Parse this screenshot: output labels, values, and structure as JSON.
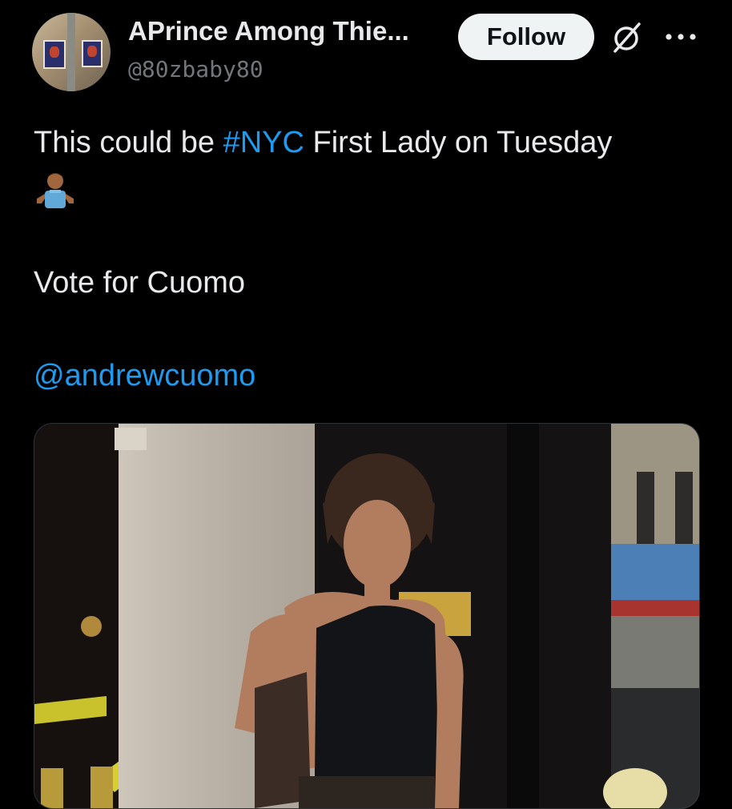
{
  "author": {
    "display_name": "APrince Among Thie...",
    "handle": "@80zbaby80",
    "avatar_icon": "profile-avatar"
  },
  "header": {
    "follow_label": "Follow",
    "grok_icon": "grok-slashed-circle-icon",
    "more_icon": "more-dots-icon"
  },
  "tweet": {
    "line1_prefix": "This could be ",
    "hashtag": "#NYC",
    "line1_suffix": " First Lady on Tuesday",
    "emoji": "person-shrugging-emoji",
    "line2": "Vote for Cuomo",
    "mention": "@andrewcuomo"
  },
  "media": {
    "type": "photo",
    "icon": "attached-photo"
  },
  "colors": {
    "background": "#000000",
    "text": "#e7e9ea",
    "secondary_text": "#71767b",
    "link": "#1d9bf0",
    "follow_button_bg": "#eff3f4",
    "follow_button_text": "#0f1419"
  }
}
